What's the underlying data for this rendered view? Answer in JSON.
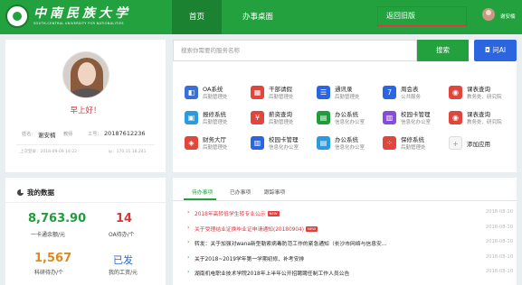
{
  "header": {
    "logo_cn": "中南民族大学",
    "logo_en": "SOUTH-CENTRAL UNIVERSITY FOR NATIONALITIES",
    "nav": [
      "首页",
      "办事桌面"
    ],
    "old_version": "返回旧版",
    "user": "谢安楠"
  },
  "profile": {
    "greeting": "早上好！",
    "name_label": "姓名:",
    "name": "谢安楠",
    "role": "教师",
    "id_label": "工号:",
    "id": "20187612236",
    "last_login": "上次登录：2018-09-09 14:22",
    "ip": "ip：170.11.18.241"
  },
  "stats": {
    "title": "我的数据",
    "items": [
      {
        "value": "8,763.90",
        "label": "一卡通余额/元",
        "color": "#1e9e3a"
      },
      {
        "value": "14",
        "label": "OA待办/个",
        "color": "#d9363e"
      },
      {
        "value": "1,567",
        "label": "科研待办/个",
        "color": "#e08a1e"
      },
      {
        "value": "已发",
        "label": "我的工资/元",
        "color": "#2b66e0"
      }
    ]
  },
  "search": {
    "placeholder": "搜索你需要的服务名称",
    "button": "搜索",
    "ai_button": "问AI",
    "ai_icon": "robot-icon"
  },
  "services": [
    {
      "name": "OA系统",
      "dept": "后勤管理处",
      "color": "#3b6fd8",
      "icon": "oa-icon",
      "glyph": "◧"
    },
    {
      "name": "干部请假",
      "dept": "后勤管理处",
      "color": "#e0463c",
      "icon": "calendar-icon",
      "glyph": "▦"
    },
    {
      "name": "通讯录",
      "dept": "后勤管理处",
      "color": "#2b66e0",
      "icon": "contacts-icon",
      "glyph": "☰"
    },
    {
      "name": "周会表",
      "dept": "公共服务",
      "color": "#2b66e0",
      "icon": "calendar-7-icon",
      "glyph": "7"
    },
    {
      "name": "课表查询",
      "dept": "教务处、研究院",
      "color": "#e0463c",
      "icon": "schedule-icon",
      "glyph": "◉"
    },
    {
      "name": "报修系统",
      "dept": "后勤管理处",
      "color": "#2b9adf",
      "icon": "repair-icon",
      "glyph": "▣"
    },
    {
      "name": "薪资查询",
      "dept": "后勤管理处",
      "color": "#e0463c",
      "icon": "salary-icon",
      "glyph": "¥"
    },
    {
      "name": "办公系统",
      "dept": "信息化办公室",
      "color": "#1e9e3a",
      "icon": "year-icon",
      "glyph": "▤"
    },
    {
      "name": "校园卡管理",
      "dept": "信息化办公室",
      "color": "#8a4cd8",
      "icon": "card-icon",
      "glyph": "▥"
    },
    {
      "name": "课表查询",
      "dept": "教务处、研究院",
      "color": "#e0463c",
      "icon": "schedule-icon",
      "glyph": "◉"
    },
    {
      "name": "财务大厅",
      "dept": "后勤管理处",
      "color": "#e0463c",
      "icon": "finance-icon",
      "glyph": "◈"
    },
    {
      "name": "校园卡管理",
      "dept": "信息化办公室",
      "color": "#2b66e0",
      "icon": "card-icon",
      "glyph": "▥"
    },
    {
      "name": "办公系统",
      "dept": "信息化办公室",
      "color": "#2b9adf",
      "icon": "office-icon",
      "glyph": "▤"
    },
    {
      "name": "保修系统",
      "dept": "后勤管理处",
      "color": "#e0463c",
      "icon": "dice-icon",
      "glyph": "⁘"
    },
    {
      "name": "添加应用",
      "dept": "",
      "color": "#f5f5f5",
      "icon": "plus-icon",
      "glyph": "+"
    }
  ],
  "tabs": [
    "待办事项",
    "已办事项",
    "跟踪事项"
  ],
  "todos": [
    {
      "text": "2018年高转低学生转专业公示",
      "new": "NEW",
      "color": "#d9363e",
      "date": "2018-08-10"
    },
    {
      "text": "关于受理结业证换毕业证申请通知(20180904)",
      "new": "NEW",
      "color": "#d9363e",
      "date": "2018-08-10"
    },
    {
      "text": "转发：关于加强对wana新型勒索病毒防范工作的紧急通知（长沙市网络与信息安…",
      "new": "",
      "color": "#222",
      "date": "2018-08-10"
    },
    {
      "text": "关于2018~2019学年第一学期初修、补考安排",
      "new": "",
      "color": "#222",
      "date": "2018-08-10"
    },
    {
      "text": "湖南机电职业技术学院2018年上半年公开招聘聘任制工作人员公告",
      "new": "",
      "color": "#222",
      "date": "2018-08-10"
    }
  ]
}
